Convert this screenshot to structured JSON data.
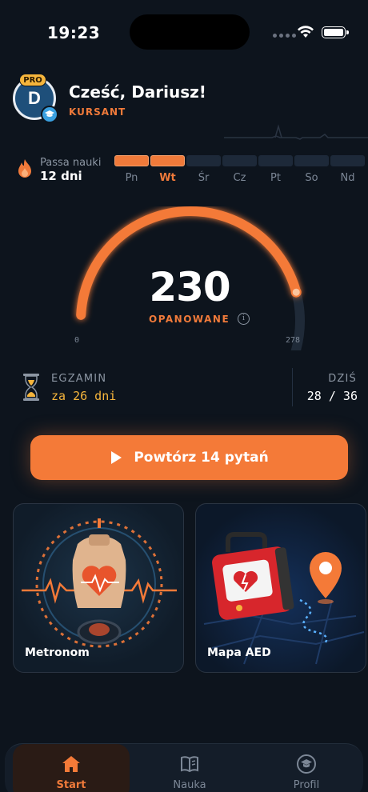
{
  "status_bar": {
    "time": "19:23"
  },
  "header": {
    "avatar_initial": "D",
    "badge": "PRO",
    "greeting": "Cześć, Dariusz!",
    "role": "KURSANT"
  },
  "streak": {
    "label": "Passa nauki",
    "value": "12 dni",
    "days": [
      {
        "label": "Pn",
        "active": true
      },
      {
        "label": "Wt",
        "active": true,
        "today": true
      },
      {
        "label": "Śr",
        "active": false
      },
      {
        "label": "Cz",
        "active": false
      },
      {
        "label": "Pt",
        "active": false
      },
      {
        "label": "So",
        "active": false
      },
      {
        "label": "Nd",
        "active": false
      }
    ]
  },
  "gauge": {
    "value": "230",
    "label": "OPANOWANE",
    "min": "0",
    "max": "278",
    "progress_fraction": 0.83
  },
  "exam": {
    "label": "EGZAMIN",
    "value": "za 26 dni",
    "today_label": "DZIŚ",
    "today_value": "28 / 36"
  },
  "cta": {
    "label": "Powtórz 14 pytań"
  },
  "cards": {
    "metronom": "Metronom",
    "aed": "Mapa AED"
  },
  "nav": {
    "start": "Start",
    "nauka": "Nauka",
    "profil": "Profil"
  },
  "colors": {
    "accent": "#f47a38",
    "warning": "#f5b53c",
    "background": "#0d141d"
  }
}
